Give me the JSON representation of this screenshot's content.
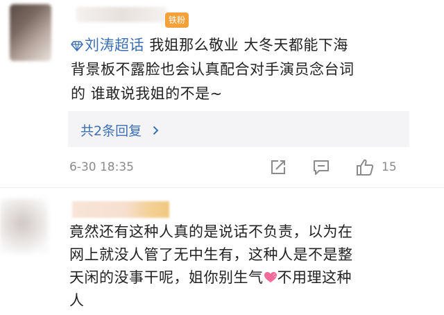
{
  "comment1": {
    "badge": "铁粉",
    "topic": "刘涛超话",
    "lines": [
      "我姐那么敬业 大冬天都能下海",
      "背景板不露脸也会认真配合对手演员念台词",
      "的 谁敢说我姐的不是~"
    ],
    "reply_link": "共2条回复",
    "timestamp": "6-30 18:35",
    "like_count": "15"
  },
  "comment2": {
    "lines": [
      "竟然还有这种人真的是说话不负责，以为在",
      "网上就没人管了无中生有，这种人是不是整",
      "天闲的没事干呢，姐你别生气",
      "不用理这种",
      "人"
    ]
  },
  "icons": {
    "topic": "diamond-icon",
    "reply_chevron": "chevron-right-icon",
    "share": "share-icon",
    "comment": "comment-icon",
    "like": "thumbs-up-icon",
    "emoji": "heart-emoji-icon"
  },
  "colors": {
    "link_blue": "#3b6fb5",
    "badge_orange": "#f3a23a",
    "meta_gray": "#8a8a8a",
    "reply_bg": "#f4f4f6"
  }
}
